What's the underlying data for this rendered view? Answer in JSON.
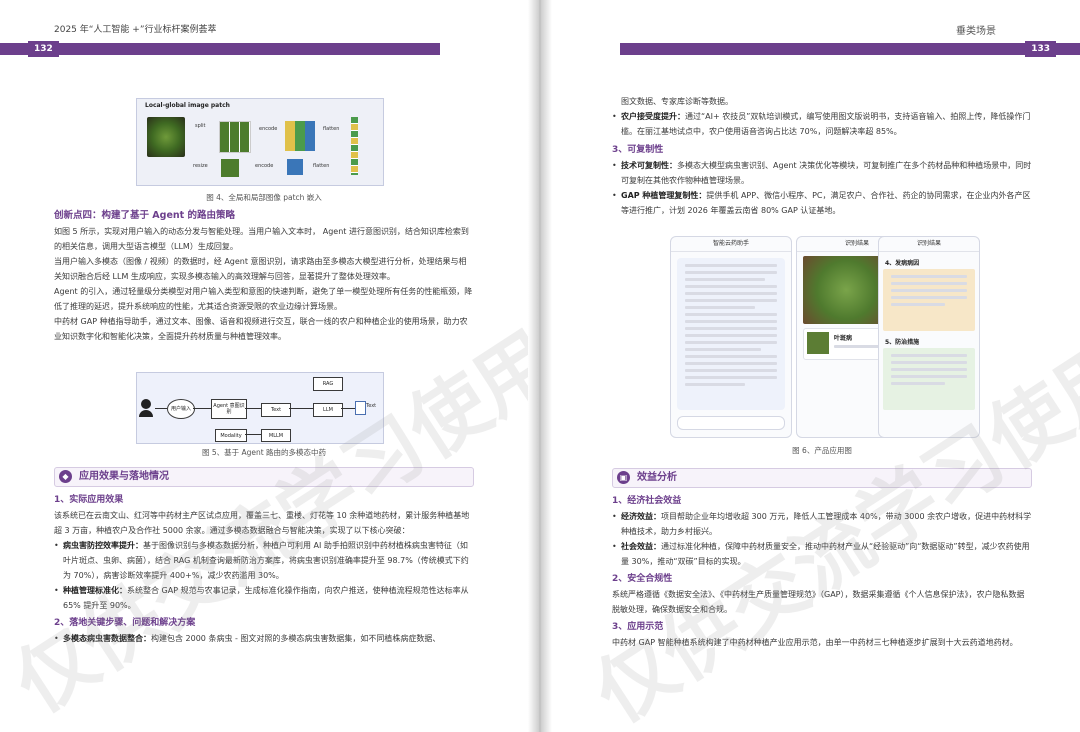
{
  "left_page": {
    "header": "2025 年“人工智能 +”行业标杆案例荟萃",
    "page_number": "132",
    "figure4": {
      "inner_title": "Local-global image patch",
      "labels": [
        "split",
        "encode",
        "flatten",
        "resize",
        "encode",
        "flatten"
      ],
      "caption": "图 4、全局和局部图像 patch 嵌入"
    },
    "innovation4": {
      "title": "创新点四：构建了基于 Agent 的路由策略",
      "paragraphs": [
        "如图 5 所示，实现对用户输入的动态分发与智能处理。当用户输入文本时， Agent 进行意图识别，结合知识库检索到的相关信息，调用大型语言模型（LLM）生成回复。",
        "当用户输入多模态（图像 / 视频）的数据时，经 Agent 意图识别，请求路由至多模态大模型进行分析，处理结果与相关知识融合后经 LLM 生成响应，实现多模态输入的高效理解与回答，显著提升了整体处理效率。",
        "Agent 的引入，通过轻量级分类模型对用户输入类型和意图的快速判断，避免了单一模型处理所有任务的性能瓶颈，降低了推理的延迟，提升系统响应的性能，尤其适合资源受限的农业边缘计算场景。",
        "中药材 GAP 种植指导助手，通过文本、图像、语音和视频进行交互，联合一线的农户和种植企业的使用场景，助力农业知识数字化和智能化决策，全面提升药材质量与种植管理效率。"
      ]
    },
    "figure5": {
      "nodes": [
        "用户输入",
        "Agent\n意图识别",
        "Text",
        "RAG",
        "LLM",
        "Modality",
        "MLLM",
        "Text"
      ],
      "caption": "图 5、基于 Agent 路由的多模态中药"
    },
    "section": {
      "title": "应用效果与落地情况"
    },
    "effect": {
      "title": "1、实际应用效果",
      "intro": "该系统已在云南文山、红河等中药材主产区试点应用，覆盖三七、重楼、灯花等 10 余种道地药材，累计服务种植基地超 3 万亩，种植农户及合作社 5000 余家。通过多模态数据融合与智能决策，实现了以下核心突破：",
      "bullets": [
        {
          "label": "病虫害防控效率提升：",
          "text": "基于图像识别与多模态数据分析，种植户可利用 AI 助手拍照识别中药材植株病虫害特征（如叶片斑点、虫卵、病菌），结合 RAG 机制查询最新防治方案库，将病虫害识别准确率提升至 98.7%（传统模式下约为 70%），病害诊断效率提升 400+%，减少农药滥用 30%。"
        },
        {
          "label": "种植管理标准化：",
          "text": "系统整合 GAP 规范与农事记录，生成标准化操作指南，向农户推送，使种植流程规范性达标率从 65% 提升至 90%。"
        }
      ]
    },
    "steps": {
      "title": "2、落地关键步骤、问题和解决方案",
      "bullets": [
        {
          "label": "多模态病虫害数据整合：",
          "text": "构建包含 2000 条病虫 - 图文对照的多模态病虫害数据集，如不同植株病症数据、"
        }
      ]
    },
    "watermark": "仅供交流学习使用"
  },
  "right_page": {
    "header": "垂类场景",
    "page_number": "133",
    "top": {
      "continuation": "图文数据、专家库诊断等数据。",
      "bullets": [
        {
          "label": "农户接受度提升：",
          "text": "通过“AI+ 农技员”双轨培训模式，编写使用图文版说明书，支持语音输入、拍照上传，降低操作门槛。在丽江基地试点中，农户使用语音咨询占比达 70%，问题解决率超 85%。"
        }
      ]
    },
    "replicability": {
      "title": "3、可复制性",
      "bullets": [
        {
          "label": "技术可复制性：",
          "text": "多模态大模型病虫害识别、Agent 决策优化等模块，可复制推广在多个药材品种和种植场景中，同时可复制在其他农作物种植管理场景。"
        },
        {
          "label": "GAP 种植管理复制性：",
          "text": "提供手机 APP、微信小程序、PC，满足农户、合作社、药企的协同需求，在企业内外各产区等进行推广，计划 2026 年覆盖云南省 80% GAP 认证基地。"
        }
      ]
    },
    "figure6": {
      "phone1_title": "智能云药助手",
      "phone2_title": "识别结果",
      "phone2_card": "叶斑病",
      "phone3_title": "识别结果",
      "phone3_sec1": "4、发病病因",
      "phone3_sec2": "5、防治措施",
      "caption": "图 6、产品应用图"
    },
    "section": {
      "title": "效益分析"
    },
    "economic": {
      "title": "1、经济社会效益",
      "bullets": [
        {
          "label": "经济效益：",
          "text": "项目帮助企业年均增收超 300 万元，降低人工管理成本 40%，带动 3000 余农户增收，促进中药材科学种植技术，助力乡村振兴。"
        },
        {
          "label": "社会效益：",
          "text": "通过标准化种植，保障中药材质量安全，推动中药材产业从“经验驱动”向“数据驱动”转型，减少农药使用量 30%，推动“双碳”目标的实现。"
        }
      ]
    },
    "security": {
      "title": "2、安全合规性",
      "text": "系统严格遵循《数据安全法》、《中药材生产质量管理规范》（GAP），数据采集遵循《个人信息保护法》，农户隐私数据脱敏处理，确保数据安全和合规。"
    },
    "demo": {
      "title": "3、应用示范",
      "text": "中药材 GAP 智能种植系统构建了中药材种植产业应用示范，由单一中药材三七种植逐步扩展到十大云药道地药材。"
    },
    "watermark": "仅供交流学习使用"
  },
  "colors": {
    "accent": "#6c3f8c",
    "figure_bg": "#eef0f7"
  }
}
